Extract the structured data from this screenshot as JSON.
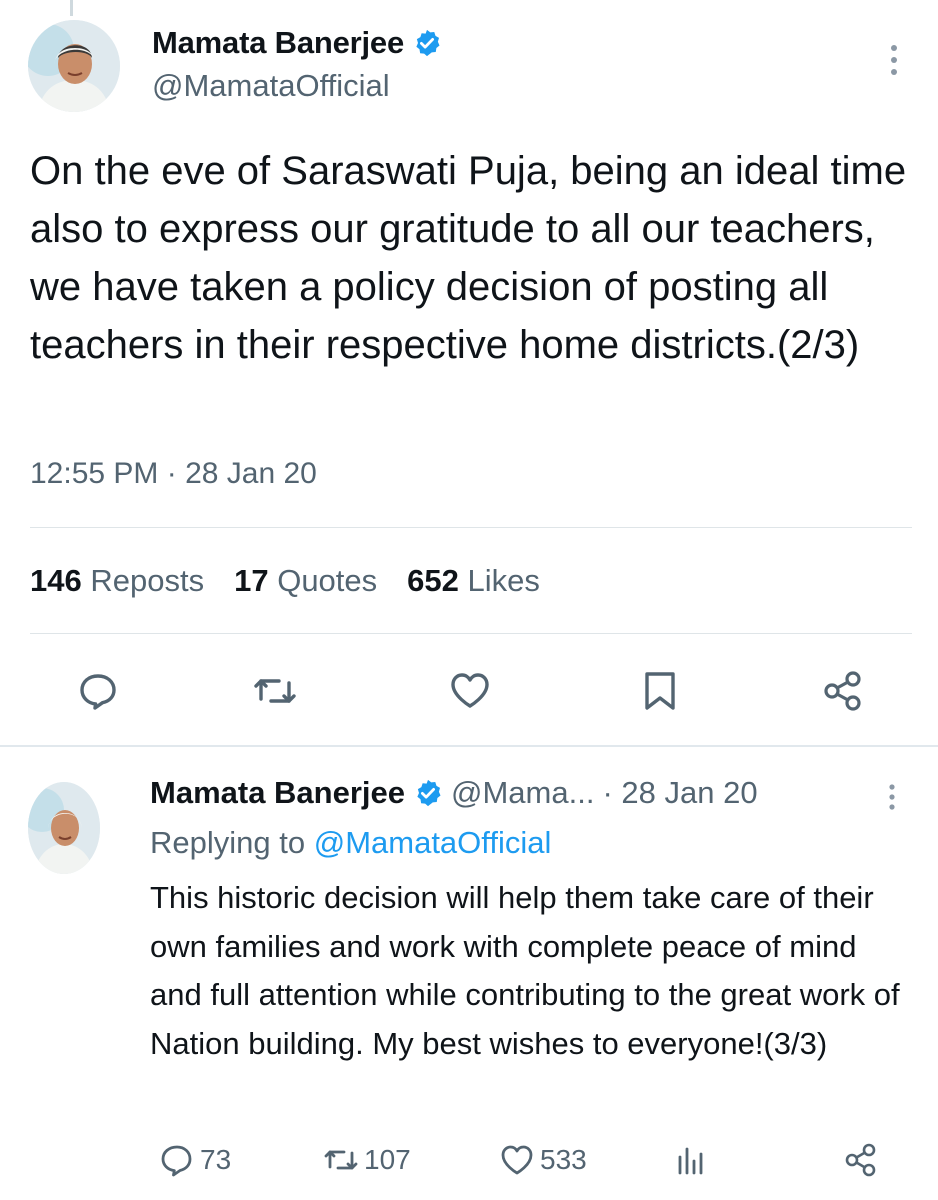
{
  "main_tweet": {
    "name": "Mamata Banerjee",
    "handle": "@MamataOfficial",
    "text": "On the eve of Saraswati Puja, being an ideal time also to express our gratitude to all our teachers, we have taken a policy decision of posting all teachers in their respective home districts.(2/3)",
    "timestamp": "12:55 PM · 28 Jan 20",
    "stats": {
      "reposts_count": "146",
      "reposts_label": "Reposts",
      "quotes_count": "17",
      "quotes_label": "Quotes",
      "likes_count": "652",
      "likes_label": "Likes"
    },
    "actions": [
      "reply-icon",
      "repost-icon",
      "like-icon",
      "bookmark-icon",
      "share-icon"
    ]
  },
  "reply_tweet": {
    "name": "Mamata Banerjee",
    "handle": "@Mama...",
    "date": "· 28 Jan 20",
    "replying_prefix": "Replying to",
    "replying_to": "@MamataOfficial",
    "text": "This historic decision will help them take care of their own families and work with complete peace of mind and full attention while contributing to the great work of Nation building. My best wishes to everyone!(3/3)",
    "replies": "73",
    "reposts": "107",
    "likes": "533"
  },
  "colors": {
    "text": "#0f1419",
    "muted": "#536471",
    "accent": "#1d9bf0",
    "divider": "#dfe5e8"
  }
}
